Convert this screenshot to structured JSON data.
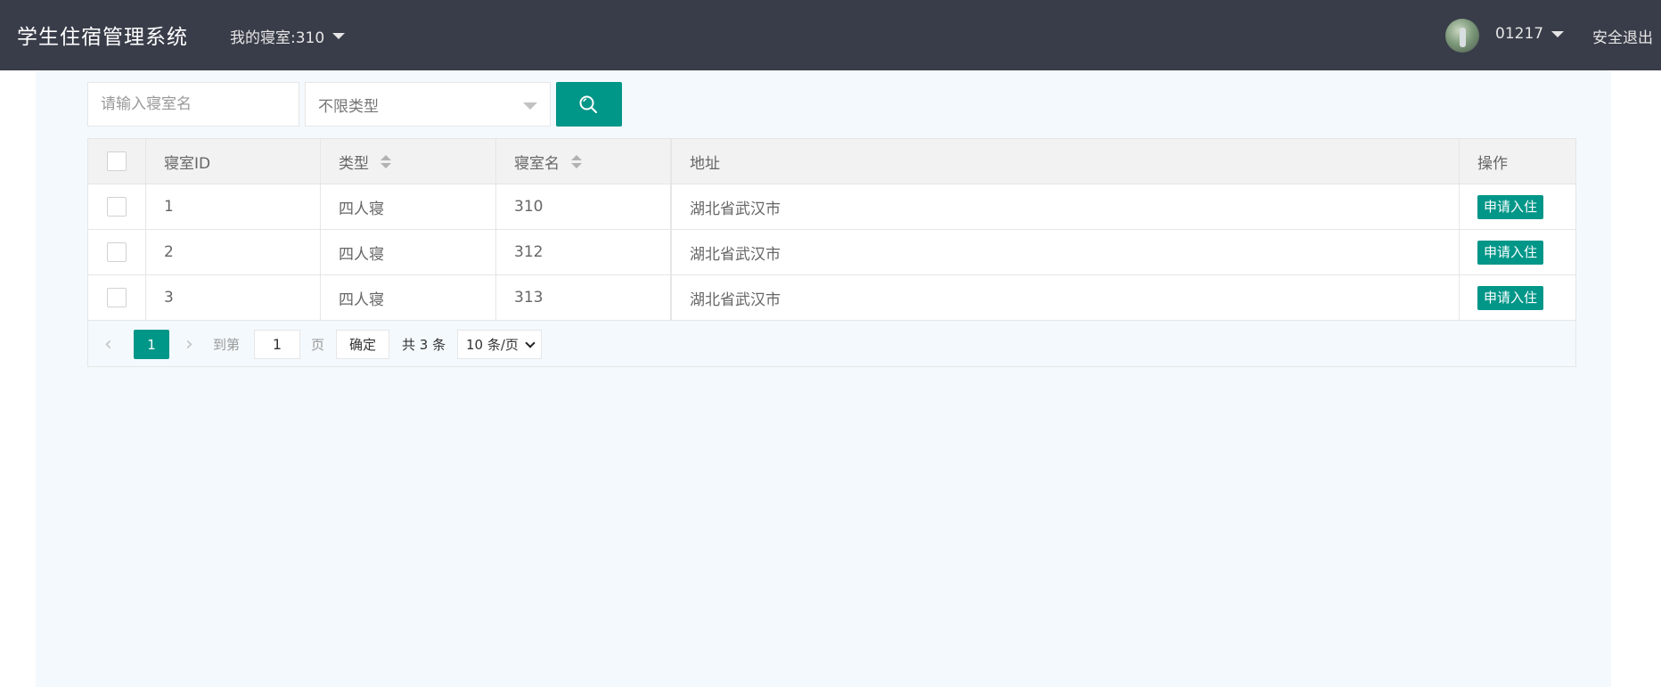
{
  "header": {
    "title": "学生住宿管理系统",
    "my_dorm": "我的寝室:310",
    "username": "01217",
    "logout": "安全退出"
  },
  "search": {
    "placeholder": "请输入寝室名",
    "type_select": "不限类型",
    "search_icon": "search-icon"
  },
  "table": {
    "columns": [
      "寝室ID",
      "类型",
      "寝室名",
      "地址",
      "操作"
    ],
    "rows": [
      {
        "id": "1",
        "type": "四人寝",
        "name": "310",
        "address": "湖北省武汉市",
        "action": "申请入住"
      },
      {
        "id": "2",
        "type": "四人寝",
        "name": "312",
        "address": "湖北省武汉市",
        "action": "申请入住"
      },
      {
        "id": "3",
        "type": "四人寝",
        "name": "313",
        "address": "湖北省武汉市",
        "action": "申请入住"
      }
    ]
  },
  "pagination": {
    "current": "1",
    "goto_label": "到第",
    "goto_value": "1",
    "page_label": "页",
    "confirm": "确定",
    "total": "共 3 条",
    "page_size": "10 条/页"
  },
  "colors": {
    "header_bg": "#393d49",
    "accent": "#009688",
    "content_bg": "#f4f9fd"
  }
}
